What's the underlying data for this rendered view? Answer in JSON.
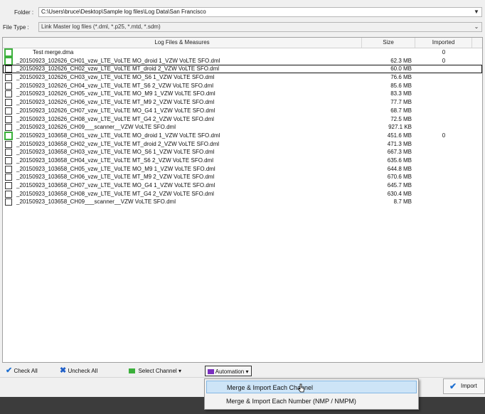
{
  "folder": {
    "label": "Folder :",
    "value": "C:\\Users\\bruce\\Desktop\\Sample log files\\Log Data\\San Francisco"
  },
  "file_type": {
    "label": "File Type :",
    "value": "Link Master log files (*.dml, *.p25, *.mtd, *.sdm)"
  },
  "columns": {
    "name": "Log Files & Measures",
    "size": "Size",
    "imported": "Imported"
  },
  "rows": [
    {
      "name": "Test merge.dma",
      "size": "",
      "imported": "0"
    },
    {
      "name": "_20150923_102626_CH01_vzw_LTE_VoLTE MO_droid 1_VZW VoLTE SFO.dml",
      "size": "62.3 MB",
      "imported": "0"
    },
    {
      "name": "_20150923_102626_CH02_vzw_LTE_VoLTE MT_droid 2_VZW VoLTE SFO.dml",
      "size": "60.0 MB",
      "imported": ""
    },
    {
      "name": "_20150923_102626_CH03_vzw_LTE_VoLTE MO_S6 1_VZW VoLTE SFO.dml",
      "size": "76.6 MB",
      "imported": ""
    },
    {
      "name": "_20150923_102626_CH04_vzw_LTE_VoLTE MT_S6 2_VZW VoLTE SFO.dml",
      "size": "85.6 MB",
      "imported": ""
    },
    {
      "name": "_20150923_102626_CH05_vzw_LTE_VoLTE MO_M9 1_VZW VoLTE SFO.dml",
      "size": "83.3 MB",
      "imported": ""
    },
    {
      "name": "_20150923_102626_CH06_vzw_LTE_VoLTE MT_M9 2_VZW VoLTE SFO.dml",
      "size": "77.7 MB",
      "imported": ""
    },
    {
      "name": "_20150923_102626_CH07_vzw_LTE_VoLTE MO_G4 1_VZW VoLTE SFO.dml",
      "size": "68.7 MB",
      "imported": ""
    },
    {
      "name": "_20150923_102626_CH08_vzw_LTE_VoLTE MT_G4 2_VZW VoLTE SFO.dml",
      "size": "72.5 MB",
      "imported": ""
    },
    {
      "name": "_20150923_102626_CH09___scanner__VZW VoLTE SFO.dml",
      "size": "927.1 KB",
      "imported": ""
    },
    {
      "name": "_20150923_103658_CH01_vzw_LTE_VoLTE MO_droid 1_VZW VoLTE SFO.dml",
      "size": "451.6 MB",
      "imported": "0"
    },
    {
      "name": "_20150923_103658_CH02_vzw_LTE_VoLTE MT_droid 2_VZW VoLTE SFO.dml",
      "size": "471.3 MB",
      "imported": ""
    },
    {
      "name": "_20150923_103658_CH03_vzw_LTE_VoLTE MO_S6 1_VZW VoLTE SFO.dml",
      "size": "667.3 MB",
      "imported": ""
    },
    {
      "name": "_20150923_103658_CH04_vzw_LTE_VoLTE MT_S6 2_VZW VoLTE SFO.dml",
      "size": "635.6 MB",
      "imported": ""
    },
    {
      "name": "_20150923_103658_CH05_vzw_LTE_VoLTE MO_M9 1_VZW VoLTE SFO.dml",
      "size": "644.8 MB",
      "imported": ""
    },
    {
      "name": "_20150923_103658_CH06_vzw_LTE_VoLTE MT_M9 2_VZW VoLTE SFO.dml",
      "size": "670.6 MB",
      "imported": ""
    },
    {
      "name": "_20150923_103658_CH07_vzw_LTE_VoLTE MO_G4 1_VZW VoLTE SFO.dml",
      "size": "645.7 MB",
      "imported": ""
    },
    {
      "name": "_20150923_103658_CH08_vzw_LTE_VoLTE MT_G4 2_VZW VoLTE SFO.dml",
      "size": "630.4 MB",
      "imported": ""
    },
    {
      "name": "_20150923_103658_CH09___scanner__VZW VoLTE SFO.dml",
      "size": "8.7 MB",
      "imported": ""
    }
  ],
  "toolbar": {
    "check_all": "Check All",
    "uncheck_all": "Uncheck All",
    "select_channel": "Select Channel",
    "automation": "Automation"
  },
  "menu": {
    "item1": "Merge & Import Each Channel",
    "item2": "Merge & Import Each Number (NMP / NMPM)"
  },
  "import_button": "Import",
  "colors": {
    "check_green": "#3bb03b",
    "accent_blue": "#1e6fd0",
    "uncheck_blue": "#1f5fc8",
    "purple": "#7a2fbf"
  }
}
